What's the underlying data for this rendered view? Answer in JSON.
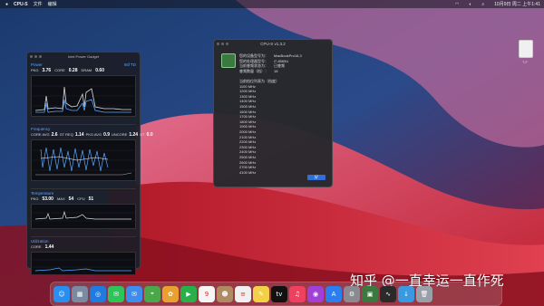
{
  "menubar": {
    "app_name": "CPU-S",
    "menus": [
      "文件",
      "编辑"
    ],
    "clock": "10月9日 周二 上午1:41"
  },
  "desktop": {
    "disk_label": "T-F"
  },
  "power_gadget": {
    "title": "Intel Power Gadget",
    "power": {
      "title": "Power",
      "limit": "Intf TD",
      "stats": [
        {
          "label": "PKG",
          "value": "3.76"
        },
        {
          "label": "CORE",
          "value": "0.28"
        },
        {
          "label": "DRAM",
          "value": "0.60"
        }
      ]
    },
    "frequency": {
      "title": "Frequency",
      "stats": [
        {
          "label": "CORE AVG",
          "value": "2.6"
        },
        {
          "label": "GT REQ",
          "value": "1.14"
        },
        {
          "label": "PKG AVG",
          "value": "0.9"
        },
        {
          "label": "UNCORE",
          "value": "1.24"
        },
        {
          "label": "GT",
          "value": "0.0"
        }
      ]
    },
    "temperature": {
      "title": "Temperature",
      "stats": [
        {
          "label": "PKG",
          "value": "53.00"
        },
        {
          "label": "MAX",
          "value": "54"
        },
        {
          "label": "CPU",
          "value": "51"
        }
      ]
    },
    "utilization": {
      "title": "Utilization",
      "stats": [
        {
          "label": "CORE",
          "value": "1.44"
        }
      ]
    }
  },
  "cpu_window": {
    "title": "CPU-S v1.3.2",
    "info": [
      {
        "key": "您的设备型号为：",
        "value": "MacBookPro16,3"
      },
      {
        "key": "您的处理器型号：",
        "value": "i7-8565U"
      },
      {
        "key": "当前睿频状态为：",
        "value": "已睿频"
      },
      {
        "key": "睿频数量（档）：",
        "value": "18"
      }
    ],
    "freq_header": "当前档位列表为（档度）",
    "frequencies": [
      "1100 MHz",
      "1200 MHz",
      "1300 MHz",
      "1400 MHz",
      "1500 MHz",
      "1600 MHz",
      "1700 MHz",
      "1800 MHz",
      "1900 MHz",
      "2000 MHz",
      "2100 MHz",
      "2200 MHz",
      "2300 MHz",
      "2400 MHz",
      "2500 MHz",
      "2600 MHz",
      "2700 MHz",
      "4100 MHz"
    ],
    "ok_label": "好"
  },
  "dock": {
    "apps": [
      {
        "name": "finder",
        "glyph": "☺",
        "color": "#2a8ef0"
      },
      {
        "name": "launchpad",
        "glyph": "▦",
        "color": "#7a8aa0"
      },
      {
        "name": "safari",
        "glyph": "◎",
        "color": "#1f7be0"
      },
      {
        "name": "messages",
        "glyph": "✉",
        "color": "#2ec45a"
      },
      {
        "name": "mail",
        "glyph": "✉",
        "color": "#3d8cf0"
      },
      {
        "name": "maps",
        "glyph": "⌖",
        "color": "#4aa84a"
      },
      {
        "name": "photos",
        "glyph": "✿",
        "color": "#e8a030"
      },
      {
        "name": "facetime",
        "glyph": "▶",
        "color": "#2ab04a"
      },
      {
        "name": "calendar",
        "glyph": "9",
        "color": "#f5f5f5"
      },
      {
        "name": "contacts",
        "glyph": "☻",
        "color": "#b08a60"
      },
      {
        "name": "reminders",
        "glyph": "≡",
        "color": "#f0f0f0"
      },
      {
        "name": "notes",
        "glyph": "✎",
        "color": "#f2d048"
      },
      {
        "name": "tv",
        "glyph": "tv",
        "color": "#111111"
      },
      {
        "name": "music",
        "glyph": "♫",
        "color": "#f04060"
      },
      {
        "name": "podcasts",
        "glyph": "◉",
        "color": "#a040d8"
      },
      {
        "name": "app-store",
        "glyph": "A",
        "color": "#2a7ef0"
      },
      {
        "name": "system-preferences",
        "glyph": "⚙",
        "color": "#8a8a90"
      },
      {
        "name": "cpu-s",
        "glyph": "▣",
        "color": "#3b7a3e"
      },
      {
        "name": "activity-monitor",
        "glyph": "∿",
        "color": "#2a2a2a"
      },
      {
        "name": "downloads",
        "glyph": "↓",
        "color": "#3a9ae0"
      },
      {
        "name": "trash",
        "glyph": "🗑",
        "color": "#9aa0a8"
      }
    ]
  },
  "watermark": "知乎 @一直幸运一直作死",
  "colors": {
    "accent": "#58a6ff",
    "ok_button": "#2f6fd6"
  }
}
